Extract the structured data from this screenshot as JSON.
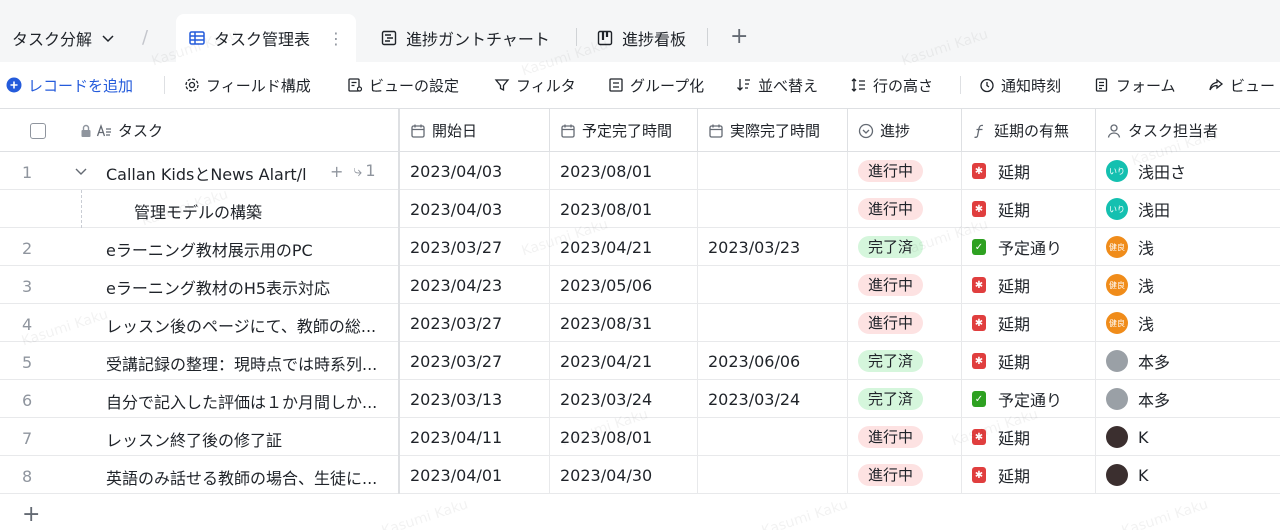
{
  "tabbar": {
    "base_title": "タスク分解",
    "tabs": [
      {
        "label": "タスク管理表",
        "icon": "table-icon",
        "active": true
      },
      {
        "label": "進捗ガントチャート",
        "icon": "gantt-icon",
        "active": false
      },
      {
        "label": "進捗看板",
        "icon": "kanban-icon",
        "active": false
      }
    ]
  },
  "toolbar": {
    "add_record": "レコードを追加",
    "field_config": "フィールド構成",
    "view_settings": "ビューの設定",
    "filter": "フィルタ",
    "group": "グループ化",
    "sort": "並べ替え",
    "row_height": "行の高さ",
    "notify_time": "通知時刻",
    "form": "フォーム",
    "view": "ビュー"
  },
  "columns": {
    "task": "タスク",
    "start": "開始日",
    "planned_end": "予定完了時間",
    "actual_end": "実際完了時間",
    "progress": "進捗",
    "delay": "延期の有無",
    "assignee": "タスク担当者"
  },
  "rows": [
    {
      "num": "1",
      "task": "Callan KidsとNews Alart/l",
      "subcount": "1",
      "start": "2023/04/03",
      "planned": "2023/08/01",
      "actual": "",
      "progress": "進行中",
      "progress_kind": "progress",
      "delay": "延期",
      "delay_kind": "delay",
      "assignee": "浅田さ",
      "avatar_color": "#14c0b0",
      "avatar_text": "いり"
    },
    {
      "num": "",
      "task": "管理モデルの構築",
      "subtask": true,
      "start": "2023/04/03",
      "planned": "2023/08/01",
      "actual": "",
      "progress": "進行中",
      "progress_kind": "progress",
      "delay": "延期",
      "delay_kind": "delay",
      "assignee": "浅田",
      "avatar_color": "#14c0b0",
      "avatar_text": "いり"
    },
    {
      "num": "2",
      "task": "eラーニング教材展示用のPC",
      "start": "2023/03/27",
      "planned": "2023/04/21",
      "actual": "2023/03/23",
      "progress": "完了済",
      "progress_kind": "done",
      "delay": "予定通り",
      "delay_kind": "ok",
      "assignee": "浅",
      "avatar_color": "#f08c1a",
      "avatar_text": "健良"
    },
    {
      "num": "3",
      "task": "eラーニング教材のH5表示対応",
      "start": "2023/04/23",
      "planned": "2023/05/06",
      "actual": "",
      "progress": "進行中",
      "progress_kind": "progress",
      "delay": "延期",
      "delay_kind": "delay",
      "assignee": "浅",
      "avatar_color": "#f08c1a",
      "avatar_text": "健良"
    },
    {
      "num": "4",
      "task": "レッスン後のページにて、教師の総...",
      "start": "2023/03/27",
      "planned": "2023/08/31",
      "actual": "",
      "progress": "進行中",
      "progress_kind": "progress",
      "delay": "延期",
      "delay_kind": "delay",
      "assignee": "浅",
      "avatar_color": "#f08c1a",
      "avatar_text": "健良"
    },
    {
      "num": "5",
      "task": "受講記録の整理：現時点では時系列...",
      "start": "2023/03/27",
      "planned": "2023/04/21",
      "actual": "2023/06/06",
      "progress": "完了済",
      "progress_kind": "done",
      "delay": "延期",
      "delay_kind": "delay",
      "assignee": "本多",
      "avatar_color": "#9aa0a6",
      "avatar_text": ""
    },
    {
      "num": "6",
      "task": "自分で記入した評価は１か月間しか...",
      "start": "2023/03/13",
      "planned": "2023/03/24",
      "actual": "2023/03/24",
      "progress": "完了済",
      "progress_kind": "done",
      "delay": "予定通り",
      "delay_kind": "ok",
      "assignee": "本多",
      "avatar_color": "#9aa0a6",
      "avatar_text": ""
    },
    {
      "num": "7",
      "task": "レッスン終了後の修了証",
      "start": "2023/04/11",
      "planned": "2023/08/01",
      "actual": "",
      "progress": "進行中",
      "progress_kind": "progress",
      "delay": "延期",
      "delay_kind": "delay",
      "assignee": "K",
      "avatar_color": "#3b2f2f",
      "avatar_text": ""
    },
    {
      "num": "8",
      "task": "英語のみ話せる教師の場合、生徒に...",
      "start": "2023/04/01",
      "planned": "2023/04/30",
      "actual": "",
      "progress": "進行中",
      "progress_kind": "progress",
      "delay": "延期",
      "delay_kind": "delay",
      "assignee": "K",
      "avatar_color": "#3b2f2f",
      "avatar_text": ""
    }
  ],
  "watermark_text": "Kasumi Kaku",
  "accent_color": "#245bdb"
}
